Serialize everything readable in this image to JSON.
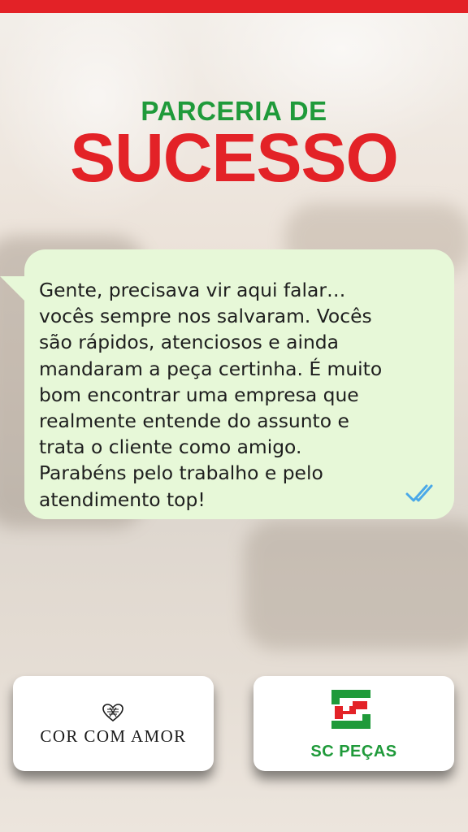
{
  "colors": {
    "accent_red": "#e32227",
    "accent_green": "#1f9a3a",
    "bubble_bg": "#e7f8d8",
    "check_blue": "#4aa8e8"
  },
  "header": {
    "subtitle": "PARCERIA DE",
    "title": "SUCESSO"
  },
  "message": {
    "text": "Gente, precisava vir aqui falar…\nvocês sempre nos salvaram. Vocês\nsão rápidos, atenciosos e ainda\nmandaram a peça certinha. É muito\nbom encontrar uma empresa que\nrealmente entende do assunto e\ntrata o cliente como amigo.\nParabéns pelo trabalho e pelo\natendimento top!",
    "status_icon": "double-check-icon"
  },
  "partners": {
    "left": {
      "name": "COR COM AMOR",
      "icon": "heart-icon"
    },
    "right": {
      "name": "SC PEÇAS",
      "icon": "sc-logo-icon"
    }
  }
}
